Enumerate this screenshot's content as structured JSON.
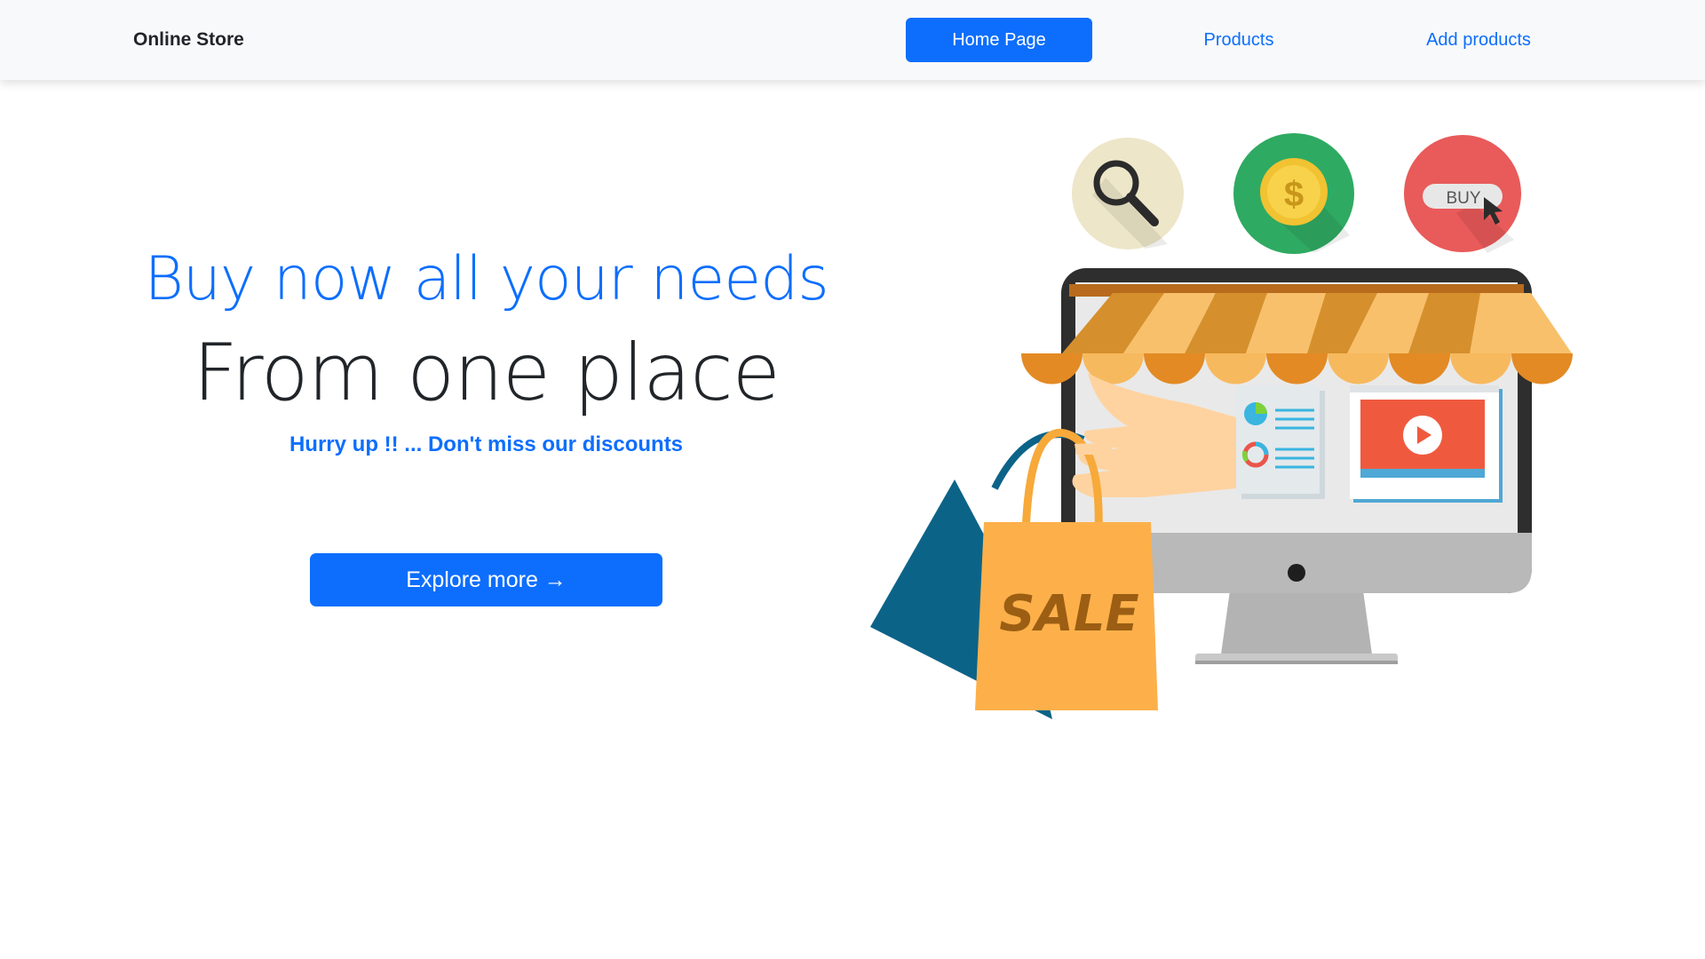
{
  "navbar": {
    "brand": "Online Store",
    "links": [
      {
        "label": "Home Page",
        "active": true
      },
      {
        "label": "Products",
        "active": false
      },
      {
        "label": "Add products",
        "active": false
      }
    ]
  },
  "hero": {
    "headline_1": "Buy now all your needs",
    "headline_2": "From one place",
    "tagline": "Hurry up !! ... Don't miss our discounts",
    "cta_label": "Explore more →"
  },
  "illustration": {
    "buy_label": "BUY",
    "dollar_label": "$",
    "sale_label": "SALE",
    "icons": [
      "magnifier-icon",
      "coin-icon",
      "buy-button-icon",
      "storefront-monitor",
      "shopping-bag"
    ]
  },
  "colors": {
    "primary": "#0d6efd",
    "nav_bg": "#f8f9fa",
    "text_dark": "#212529"
  }
}
